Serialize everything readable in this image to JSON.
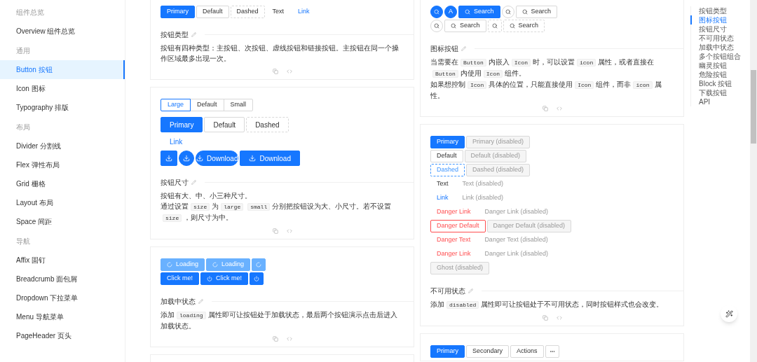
{
  "sidebar": [
    {
      "kind": "group",
      "label": "组件总览"
    },
    {
      "kind": "item",
      "label": "Overview 组件总览",
      "selected": false
    },
    {
      "kind": "group",
      "label": "通用"
    },
    {
      "kind": "item",
      "label": "Button 按钮",
      "selected": true
    },
    {
      "kind": "item",
      "label": "Icon 图标",
      "selected": false
    },
    {
      "kind": "item",
      "label": "Typography 排版",
      "selected": false
    },
    {
      "kind": "group",
      "label": "布局"
    },
    {
      "kind": "item",
      "label": "Divider 分割线",
      "selected": false
    },
    {
      "kind": "item",
      "label": "Flex 弹性布局",
      "selected": false
    },
    {
      "kind": "item",
      "label": "Grid 栅格",
      "selected": false
    },
    {
      "kind": "item",
      "label": "Layout 布局",
      "selected": false
    },
    {
      "kind": "item",
      "label": "Space 间距",
      "selected": false
    },
    {
      "kind": "group",
      "label": "导航"
    },
    {
      "kind": "item",
      "label": "Affix 固钉",
      "selected": false
    },
    {
      "kind": "item",
      "label": "Breadcrumb 面包屑",
      "selected": false
    },
    {
      "kind": "item",
      "label": "Dropdown 下拉菜单",
      "selected": false
    },
    {
      "kind": "item",
      "label": "Menu 导航菜单",
      "selected": false
    },
    {
      "kind": "item",
      "label": "PageHeader 页头",
      "selected": false
    }
  ],
  "columns": [
    {
      "cards": [
        {
          "rows": [
            {
              "kind": "buttons-middle",
              "items": [
                {
                  "kind": "primary",
                  "label": "Primary"
                },
                {
                  "kind": "default",
                  "label": "Default"
                },
                {
                  "kind": "dashed",
                  "label": "Dashed"
                },
                {
                  "kind": "text",
                  "label": "Text"
                },
                {
                  "kind": "link",
                  "label": "Link"
                }
              ]
            }
          ],
          "title": "按钮类型",
          "desc": [
            [
              {
                "kind": "text",
                "text": "按钮有四种类型：主按钮、次按钮、虚线按钮和链接按钮。主按钮在同一个操作区域最多出现一次。"
              }
            ]
          ]
        },
        {
          "rows": [
            {
              "kind": "radio",
              "items": [
                {
                  "label": "Large",
                  "selected": true
                },
                {
                  "label": "Default",
                  "selected": false
                },
                {
                  "label": "Small",
                  "selected": false
                }
              ]
            },
            {
              "kind": "buttons-large",
              "items": [
                {
                  "kind": "primary",
                  "label": "Primary"
                },
                {
                  "kind": "default",
                  "label": "Default"
                },
                {
                  "kind": "dashed",
                  "label": "Dashed"
                }
              ]
            },
            {
              "kind": "buttons-large",
              "items": [
                {
                  "kind": "link",
                  "label": "Link"
                }
              ]
            },
            {
              "kind": "buttons-large",
              "items": [
                {
                  "kind": "primary-download"
                },
                {
                  "kind": "primary-download-circle"
                },
                {
                  "kind": "primary-download-round",
                  "label": "Download"
                },
                {
                  "kind": "primary-download",
                  "label": "Download"
                }
              ]
            }
          ],
          "title": "按钮尺寸",
          "desc": [
            [
              {
                "kind": "text",
                "text": "按钮有大、中、小三种尺寸。"
              }
            ],
            [
              {
                "kind": "text",
                "text": "通过设置"
              },
              {
                "kind": "code",
                "text": "size"
              },
              {
                "kind": "text",
                "text": "为"
              },
              {
                "kind": "code",
                "text": "large"
              },
              {
                "kind": "code",
                "text": "small"
              },
              {
                "kind": "text",
                "text": "分别把按钮设为大、小尺寸。若不设置"
              },
              {
                "kind": "code",
                "text": "size"
              },
              {
                "kind": "text",
                "text": "，则尺寸为中。"
              }
            ]
          ]
        },
        {
          "rows": [
            {
              "kind": "buttons-middle",
              "items": [
                {
                  "kind": "primary",
                  "label": "Loading",
                  "loading": true
                },
                {
                  "kind": "primary",
                  "label": "Loading",
                  "loading": true
                },
                {
                  "kind": "primary",
                  "loading": true
                }
              ]
            },
            {
              "kind": "buttons-middle",
              "items": [
                {
                  "kind": "primary",
                  "label": "Click me!",
                  "loading": false
                },
                {
                  "kind": "primary-power",
                  "label": "Click me!",
                  "loading": false
                },
                {
                  "kind": "primary-power",
                  "loading": false
                }
              ]
            }
          ],
          "title": "加载中状态",
          "desc": [
            [
              {
                "kind": "text",
                "text": "添加"
              },
              {
                "kind": "code",
                "text": "loading"
              },
              {
                "kind": "text",
                "text": "属性即可让按钮处于加载状态，最后两个按钮演示点击后进入加载状态。"
              }
            ]
          ]
        }
      ]
    },
    {
      "cards": [
        {
          "rows": [
            {
              "kind": "buttons-middle",
              "items": [
                {
                  "kind": "primary-search-circle"
                },
                {
                  "kind": "primary-circle",
                  "label": "A"
                },
                {
                  "kind": "primary-search",
                  "label": "Search"
                },
                {
                  "kind": "default-search-circle"
                },
                {
                  "kind": "default-search",
                  "label": "Search"
                }
              ]
            },
            {
              "kind": "buttons-middle",
              "items": [
                {
                  "kind": "default-search-circle"
                },
                {
                  "kind": "default-search",
                  "label": "Search"
                },
                {
                  "kind": "dashed-search"
                },
                {
                  "kind": "dashed-search",
                  "label": "Search"
                }
              ]
            }
          ],
          "title": "图标按钮",
          "desc": [
            [
              {
                "kind": "text",
                "text": "当需要在"
              },
              {
                "kind": "code",
                "text": "Button"
              },
              {
                "kind": "text",
                "text": "内嵌入"
              },
              {
                "kind": "code",
                "text": "Icon"
              },
              {
                "kind": "text",
                "text": "时，可以设置"
              },
              {
                "kind": "code",
                "text": "icon"
              },
              {
                "kind": "text",
                "text": "属性，或者直接在"
              },
              {
                "kind": "code",
                "text": "Button"
              },
              {
                "kind": "text",
                "text": "内使用"
              },
              {
                "kind": "code",
                "text": "Icon"
              },
              {
                "kind": "text",
                "text": "组件。"
              }
            ],
            [
              {
                "kind": "text",
                "text": "如果想控制"
              },
              {
                "kind": "code",
                "text": "Icon"
              },
              {
                "kind": "text",
                "text": "具体的位置，只能直接使用"
              },
              {
                "kind": "code",
                "text": "Icon"
              },
              {
                "kind": "text",
                "text": "组件，而非"
              },
              {
                "kind": "code",
                "text": "icon"
              },
              {
                "kind": "text",
                "text": "属性。"
              }
            ]
          ]
        },
        {
          "rows": [
            {
              "kind": "buttons-middle",
              "items": [
                {
                  "kind": "primary",
                  "label": "Primary",
                  "disabled": false
                },
                {
                  "kind": "primary",
                  "label": "Primary (disabled)",
                  "disabled": true
                }
              ]
            },
            {
              "kind": "buttons-middle",
              "items": [
                {
                  "kind": "default",
                  "label": "Default",
                  "disabled": false
                },
                {
                  "kind": "default",
                  "label": "Default (disabled)",
                  "disabled": true
                }
              ]
            },
            {
              "kind": "buttons-middle",
              "items": [
                {
                  "kind": "dashed-focus",
                  "label": "Dashed",
                  "disabled": false
                },
                {
                  "kind": "dashed",
                  "label": "Dashed (disabled)",
                  "disabled": true
                }
              ]
            },
            {
              "kind": "buttons-middle",
              "items": [
                {
                  "kind": "text",
                  "label": "Text",
                  "disabled": false
                },
                {
                  "kind": "text",
                  "label": "Text (disabled)",
                  "disabled": true
                }
              ]
            },
            {
              "kind": "buttons-middle",
              "items": [
                {
                  "kind": "link",
                  "label": "Link",
                  "disabled": false
                },
                {
                  "kind": "link",
                  "label": "Link (disabled)",
                  "disabled": true
                }
              ]
            },
            {
              "kind": "buttons-middle",
              "items": [
                {
                  "kind": "danger-link",
                  "label": "Danger Link",
                  "disabled": false
                },
                {
                  "kind": "danger-link",
                  "label": "Danger Link (disabled)",
                  "disabled": true
                }
              ]
            },
            {
              "kind": "buttons-middle",
              "items": [
                {
                  "kind": "danger-default",
                  "label": "Danger Default",
                  "disabled": false
                },
                {
                  "kind": "danger-default",
                  "label": "Danger Default (disabled)",
                  "disabled": true
                }
              ]
            },
            {
              "kind": "buttons-middle",
              "items": [
                {
                  "kind": "danger-text",
                  "label": "Danger Text",
                  "disabled": false
                },
                {
                  "kind": "danger-text",
                  "label": "Danger Text (disabled)",
                  "disabled": true
                }
              ]
            },
            {
              "kind": "buttons-middle",
              "items": [
                {
                  "kind": "danger-link",
                  "label": "Danger Link",
                  "disabled": false
                },
                {
                  "kind": "danger-link",
                  "label": "Danger Link (disabled)",
                  "disabled": true
                }
              ]
            },
            {
              "kind": "buttons-middle",
              "items": [
                {
                  "kind": "ghost",
                  "label": "Ghost (disabled)",
                  "disabled": true
                }
              ]
            }
          ],
          "title": "不可用状态",
          "desc": [
            [
              {
                "kind": "text",
                "text": "添加"
              },
              {
                "kind": "code",
                "text": "disabled"
              },
              {
                "kind": "text",
                "text": "属性即可让按钮处于不可用状态，同时按钮样式也会改变。"
              }
            ]
          ]
        },
        {
          "rows": [
            {
              "kind": "buttons-middle",
              "items": [
                {
                  "kind": "primary",
                  "label": "Primary"
                },
                {
                  "kind": "default",
                  "label": "Secondary"
                },
                {
                  "kind": "default",
                  "label": "Actions"
                },
                {
                  "kind": "default-more"
                }
              ]
            }
          ]
        }
      ]
    }
  ],
  "anchor": [
    {
      "label": "按钮类型",
      "selected": false
    },
    {
      "label": "图标按钮",
      "selected": true
    },
    {
      "label": "按钮尺寸",
      "selected": false
    },
    {
      "label": "不可用状态",
      "selected": false
    },
    {
      "label": "加载中状态",
      "selected": false
    },
    {
      "label": "多个按钮组合",
      "selected": false
    },
    {
      "label": "幽灵按钮",
      "selected": false
    },
    {
      "label": "危险按钮",
      "selected": false
    },
    {
      "label": "Block 按钮",
      "selected": false
    },
    {
      "label": "下载按钮",
      "selected": false
    },
    {
      "label": "API",
      "selected": false
    }
  ]
}
